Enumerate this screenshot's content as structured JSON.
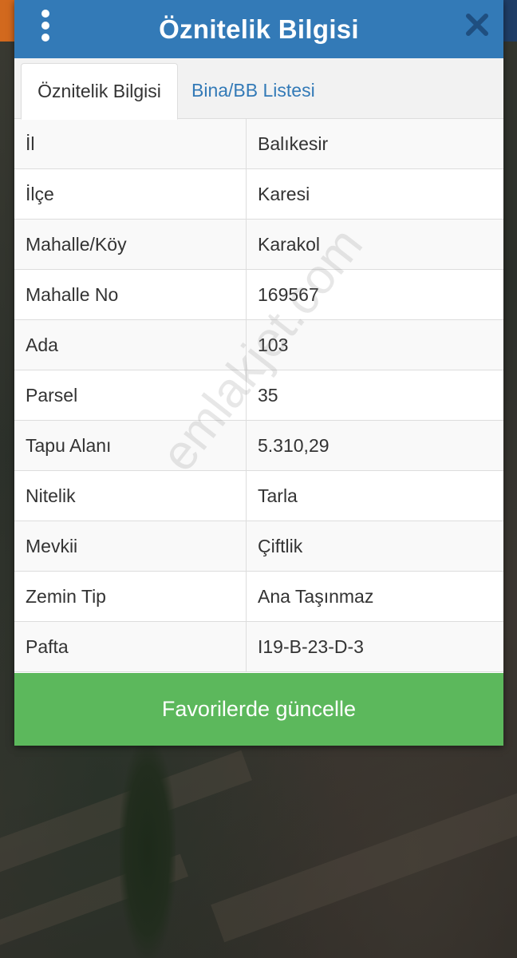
{
  "dialog": {
    "title": "Öznitelik Bilgisi",
    "menu_icon": "kebab-menu-icon",
    "close_icon": "close-icon",
    "header_color": "#337ab7"
  },
  "tabs": [
    {
      "label": "Öznitelik Bilgisi",
      "active": true
    },
    {
      "label": "Bina/BB Listesi",
      "active": false
    }
  ],
  "attributes": [
    {
      "key": "İl",
      "value": "Balıkesir"
    },
    {
      "key": "İlçe",
      "value": "Karesi"
    },
    {
      "key": "Mahalle/Köy",
      "value": "Karakol"
    },
    {
      "key": "Mahalle No",
      "value": "169567"
    },
    {
      "key": "Ada",
      "value": "103"
    },
    {
      "key": "Parsel",
      "value": "35"
    },
    {
      "key": "Tapu Alanı",
      "value": "5.310,29"
    },
    {
      "key": "Nitelik",
      "value": "Tarla"
    },
    {
      "key": "Mevkii",
      "value": "Çiftlik"
    },
    {
      "key": "Zemin Tip",
      "value": "Ana Taşınmaz"
    },
    {
      "key": "Pafta",
      "value": "I19-B-23-D-3"
    }
  ],
  "update_button": {
    "label": "Favorilerde güncelle",
    "color": "#5cb85c"
  },
  "watermark": "emlakjet.com"
}
